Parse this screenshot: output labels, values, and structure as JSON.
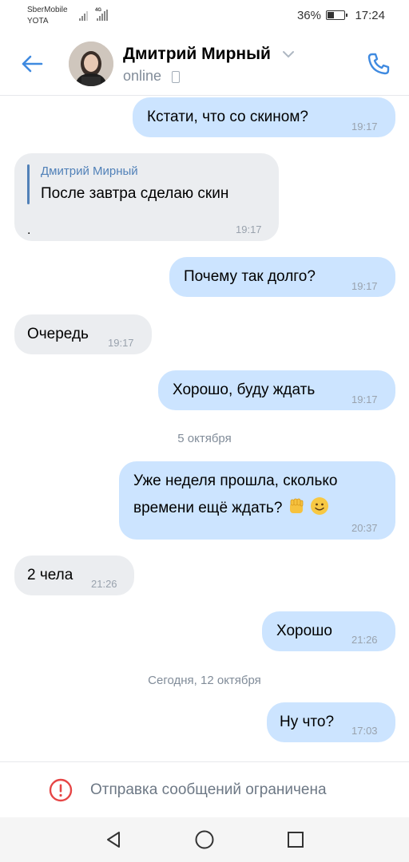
{
  "status_bar": {
    "carrier_line1": "SberMobile",
    "carrier_line2": "YOTA",
    "network": "4G",
    "battery": "36%",
    "battery_level": 0.36,
    "time": "17:24"
  },
  "header": {
    "contact_name": "Дмитрий Мирный",
    "presence": "online"
  },
  "messages": [
    {
      "dir": "out",
      "text": "Кстати, что со скином?",
      "time": "19:17"
    },
    {
      "dir": "in",
      "reply_name": "Дмитрий Мирный",
      "reply_text": "После завтра сделаю скин",
      "text": ".",
      "time": "19:17"
    },
    {
      "dir": "out",
      "text": "Почему так долго?",
      "time": "19:17"
    },
    {
      "dir": "in",
      "text": "Очередь",
      "time": "19:17"
    },
    {
      "dir": "out",
      "text": "Хорошо, буду ждать",
      "time": "19:17"
    },
    {
      "dir": "out",
      "line1": "Уже неделя прошла, сколько",
      "line2": "времени ещё ждать?",
      "time": "20:37"
    },
    {
      "dir": "in",
      "text": "2 чела",
      "time": "21:26"
    },
    {
      "dir": "out",
      "text": "Хорошо",
      "time": "21:26"
    },
    {
      "dir": "out",
      "text": "Ну что?",
      "time": "17:03"
    }
  ],
  "date_separators": [
    "5 октября",
    "Сегодня, 12 октября"
  ],
  "restricted_bar": {
    "text": "Отправка сообщений ограничена"
  },
  "colors": {
    "accent": "#3f8ae0",
    "outgoing_bubble": "#cce4ff",
    "incoming_bubble": "#ebedf0",
    "warning": "#e64646"
  }
}
